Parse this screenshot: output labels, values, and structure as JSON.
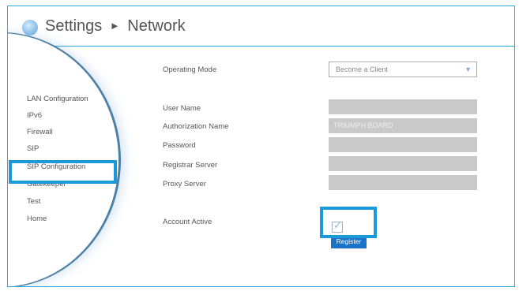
{
  "header": {
    "title": "Settings",
    "separator": "►",
    "subtitle": "Network"
  },
  "sidebar": {
    "items": [
      {
        "label": "LAN Configuration"
      },
      {
        "label": "IPv6"
      },
      {
        "label": "Firewall"
      },
      {
        "label": "SIP"
      },
      {
        "label": "SIP Configuration",
        "highlighted": true
      },
      {
        "label": "Gatekeeper"
      },
      {
        "label": "Test"
      },
      {
        "label": "Home"
      }
    ]
  },
  "form": {
    "operating_mode": {
      "label": "Operating Mode",
      "value": "Become a Client"
    },
    "user_name": {
      "label": "User Name",
      "value": ""
    },
    "authorization_name": {
      "label": "Authorization Name",
      "value": "TRIUMPH BOARD"
    },
    "password": {
      "label": "Password",
      "value": ""
    },
    "registrar_server": {
      "label": "Registrar Server",
      "value": ""
    },
    "proxy_server": {
      "label": "Proxy Server",
      "value": ""
    },
    "account_active": {
      "label": "Account Active",
      "checked": true
    },
    "register_button": "Register"
  },
  "colors": {
    "accent": "#1a9ad8",
    "button": "#1a73c9",
    "field": "#c9c9c9"
  }
}
